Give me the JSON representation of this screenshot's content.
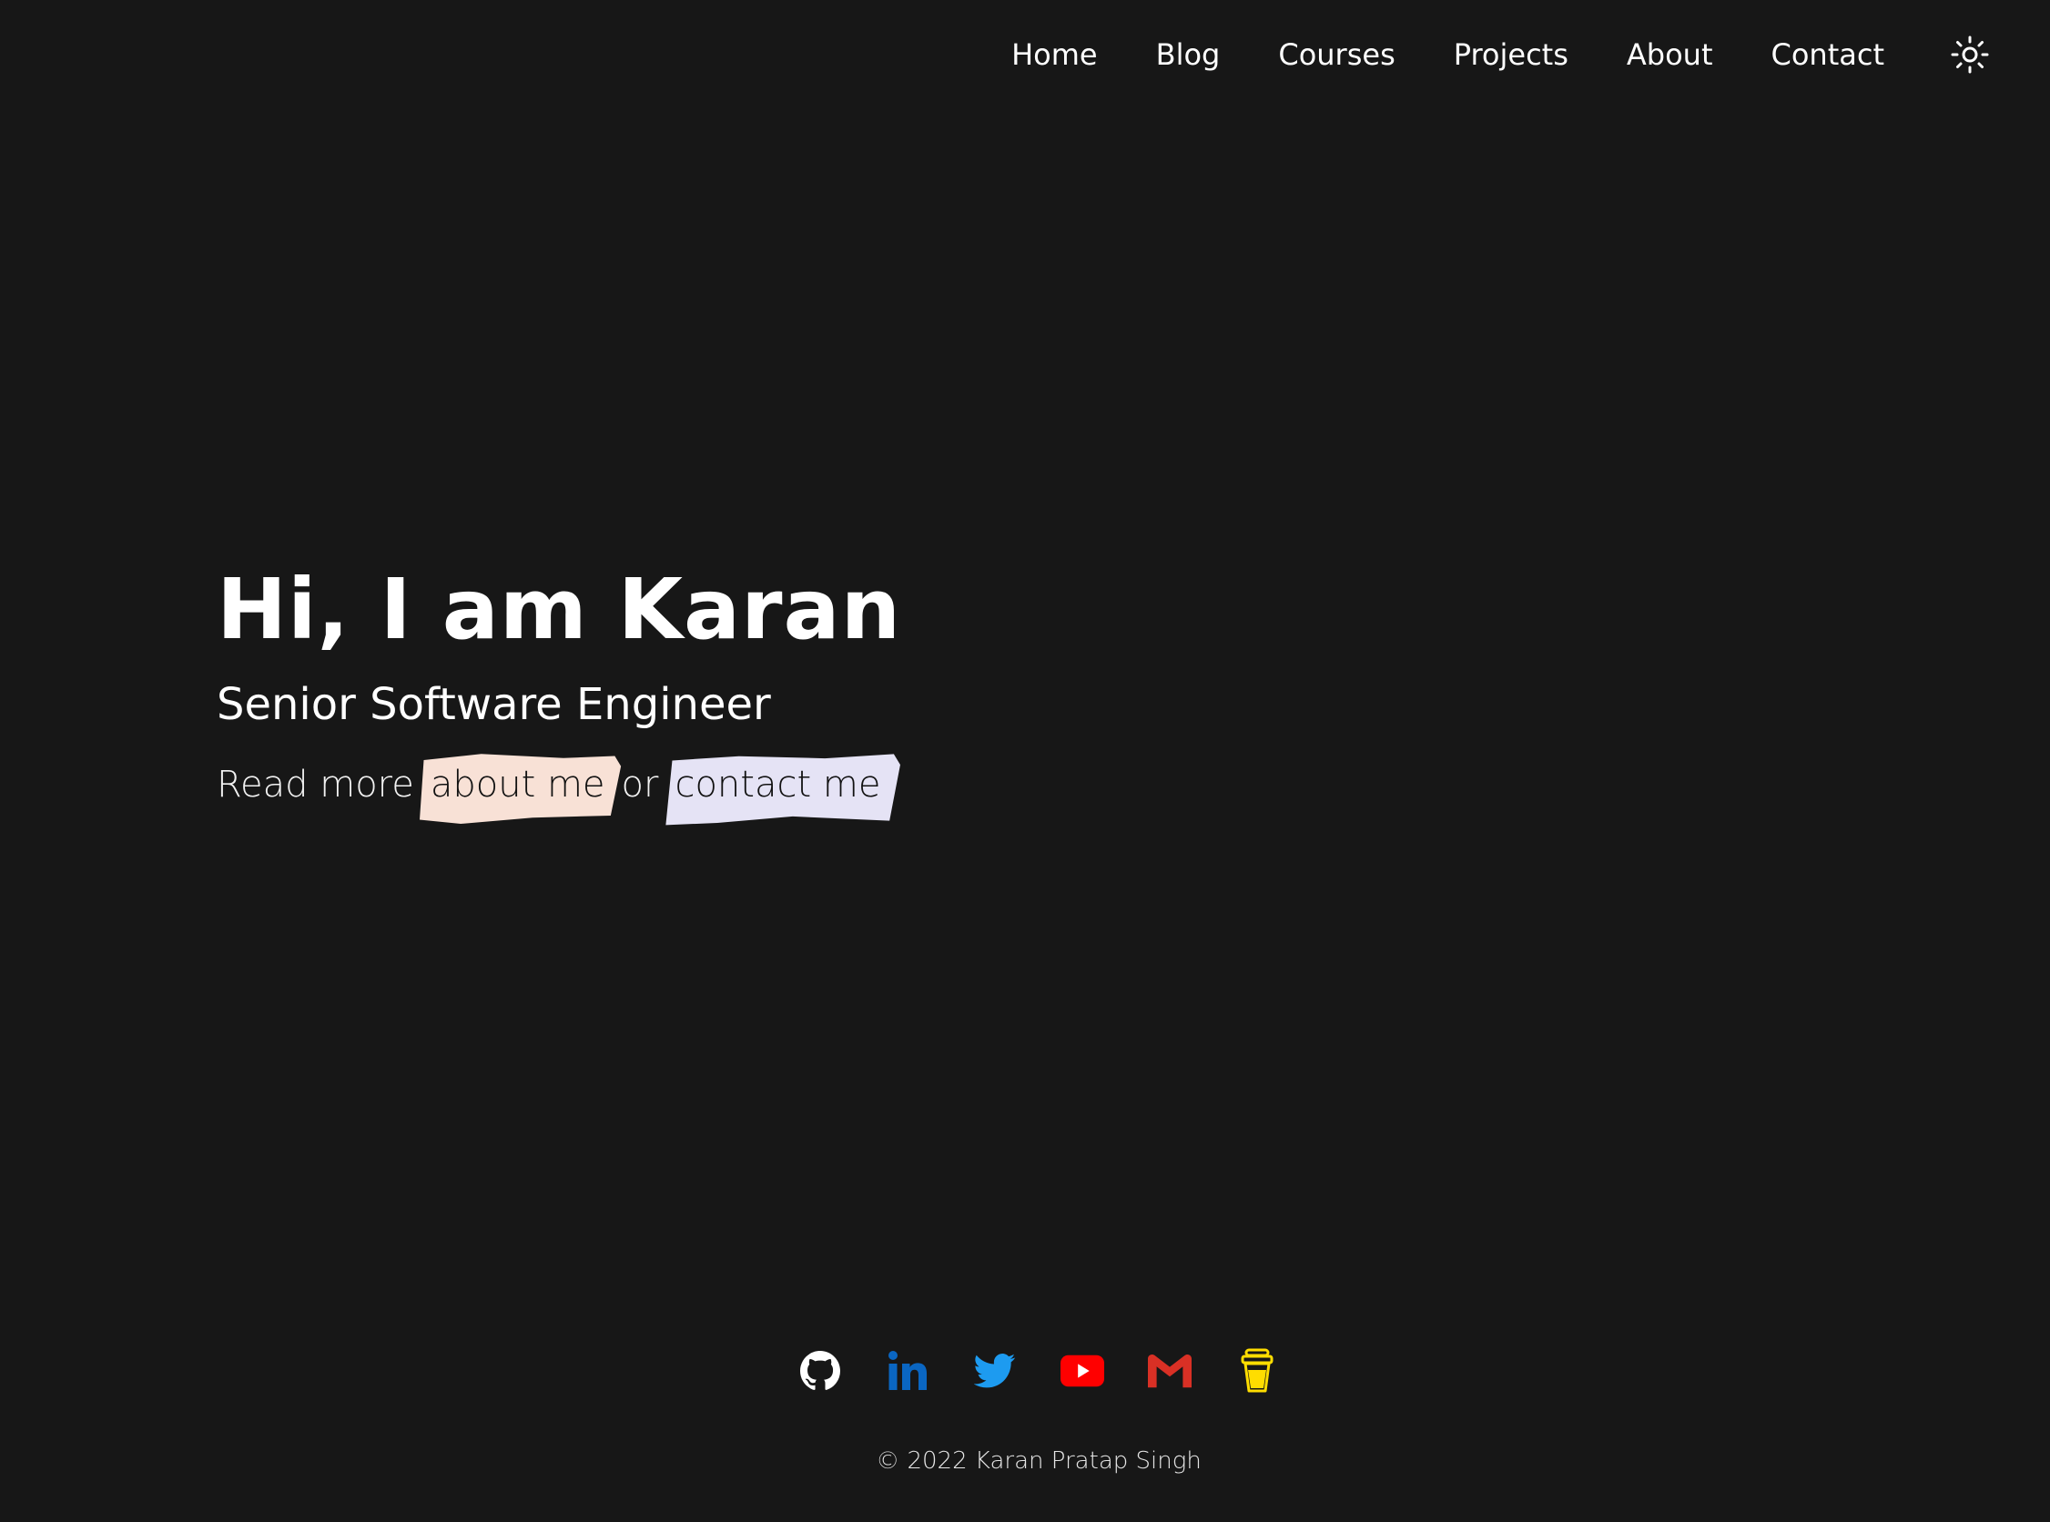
{
  "nav": {
    "items": [
      {
        "label": "Home"
      },
      {
        "label": "Blog"
      },
      {
        "label": "Courses"
      },
      {
        "label": "Projects"
      },
      {
        "label": "About"
      },
      {
        "label": "Contact"
      }
    ],
    "theme_toggle_icon": "sun-icon"
  },
  "hero": {
    "title": "Hi, I am Karan",
    "subtitle": "Senior Software Engineer",
    "cta_prefix": "Read more",
    "about_link": "about me",
    "cta_middle": "or",
    "contact_link": "contact me"
  },
  "colors": {
    "background": "#171717",
    "text": "#ffffff",
    "about_highlight": "#f8e1d6",
    "contact_highlight": "#e5e3f5",
    "github": "#ffffff",
    "linkedin": "#0a66c2",
    "twitter": "#1d9bf0",
    "youtube": "#ff0000",
    "gmail": "#d93025",
    "buymeacoffee": "#ffdd00"
  },
  "socials": [
    {
      "icon": "github-icon"
    },
    {
      "icon": "linkedin-icon"
    },
    {
      "icon": "twitter-icon"
    },
    {
      "icon": "youtube-icon"
    },
    {
      "icon": "gmail-icon"
    },
    {
      "icon": "buy-me-a-coffee-icon"
    }
  ],
  "footer": {
    "copyright": "© 2022 Karan Pratap Singh"
  }
}
